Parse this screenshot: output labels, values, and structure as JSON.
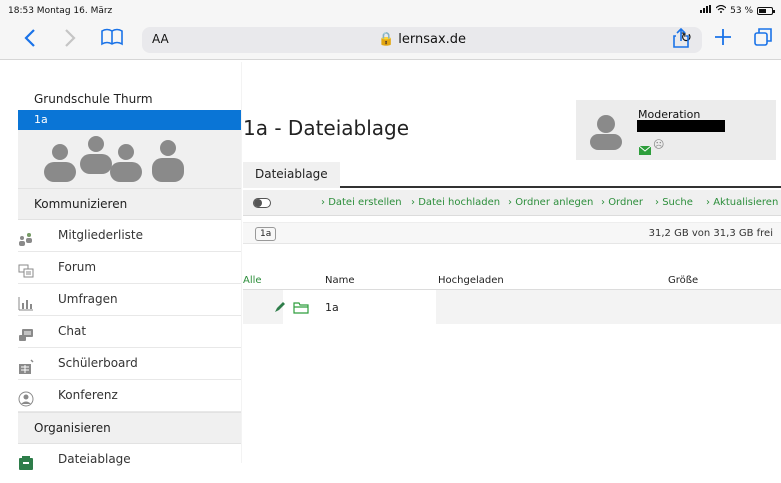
{
  "statusbar": {
    "time": "18:53  Montag 16. März",
    "battery": "53 %"
  },
  "browser": {
    "aa_label": "AA",
    "host": "lernsax.de",
    "lock": "lock-icon"
  },
  "sidebar": {
    "school": "Grundschule Thurm",
    "active_group": "1a",
    "section_communicate": "Kommunizieren",
    "items": [
      {
        "label": "Mitgliederliste",
        "icon": "members-icon"
      },
      {
        "label": "Forum",
        "icon": "forum-icon"
      },
      {
        "label": "Umfragen",
        "icon": "poll-icon"
      },
      {
        "label": "Chat",
        "icon": "chat-icon"
      },
      {
        "label": "Schülerboard",
        "icon": "board-icon"
      },
      {
        "label": "Konferenz",
        "icon": "conference-icon"
      }
    ],
    "section_organize": "Organisieren",
    "files_item": {
      "label": "Dateiablage",
      "icon": "files-icon"
    }
  },
  "main": {
    "title": "1a - Dateiablage",
    "moderation_label": "Moderation",
    "tab": "Dateiablage",
    "toolbar": [
      "Datei erstellen",
      "Datei hochladen",
      "Ordner anlegen",
      "Ordner",
      "Suche",
      "Aktualisieren"
    ],
    "crumb": "1a",
    "storage": "31,2 GB von 31,3 GB frei",
    "table": {
      "headers": {
        "all": "Alle",
        "name": "Name",
        "uploaded": "Hochgeladen",
        "size": "Größe"
      },
      "row": {
        "name": "1a"
      }
    }
  },
  "colors": {
    "accent_blue": "#0a75d6",
    "link_green": "#2c8e3b",
    "safari_blue": "#1a73e8"
  }
}
